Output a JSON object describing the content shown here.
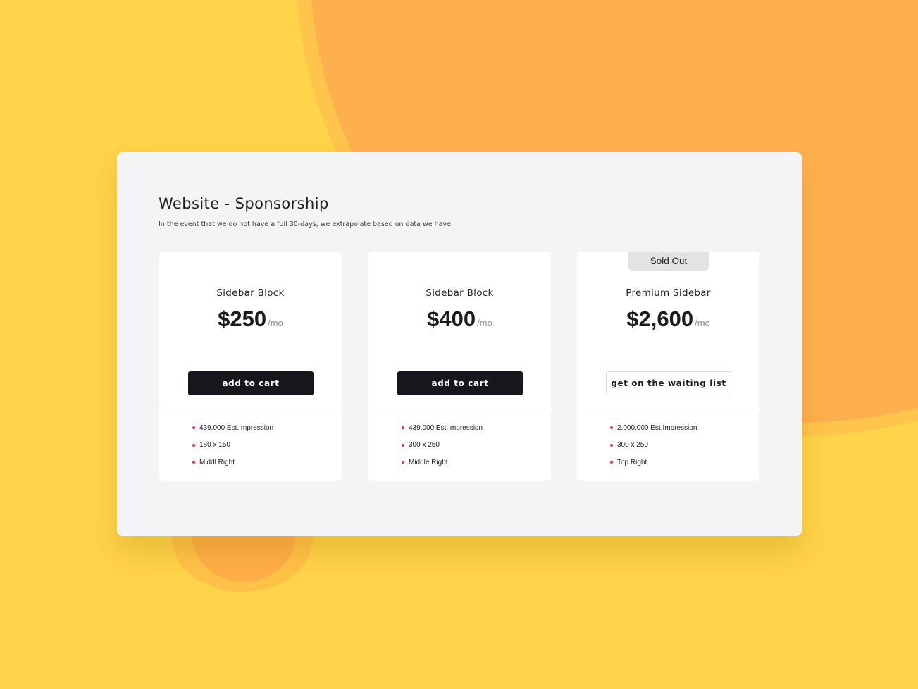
{
  "page": {
    "title": "Website - Sponsorship",
    "subtitle": "In the event that we do not have a full 30-days, we extrapolate based on data we have."
  },
  "colors": {
    "background": "#ffd34a",
    "blob": "#ffb04e",
    "panel": "#f3f4f6",
    "card": "#ffffff",
    "button_dark": "#15171c",
    "bullet": "#e8306b",
    "sold_out_tab": "#e2e3e5"
  },
  "cards": [
    {
      "name": "Sidebar Block",
      "price": "$250",
      "unit": "/mo",
      "button_label": "add to cart",
      "features": [
        "439,000 Est.Impression",
        "180 x 150",
        "Middl Right"
      ]
    },
    {
      "name": "Sidebar Block",
      "price": "$400",
      "unit": "/mo",
      "button_label": "add to cart",
      "features": [
        "439,000 Est.Impression",
        "300 x 250",
        "Middle Right"
      ]
    },
    {
      "badge": "Sold Out",
      "name": "Premium Sidebar",
      "price": "$2,600",
      "unit": "/mo",
      "button_label": "get on the waiting list",
      "features": [
        "2,000,000 Est.Impression",
        "300 x 250",
        "Top Right"
      ]
    }
  ]
}
